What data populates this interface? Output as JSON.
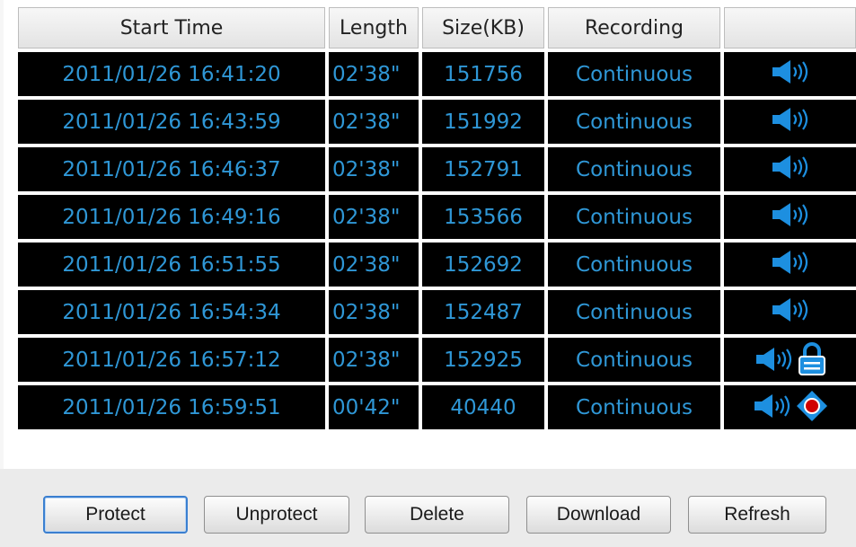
{
  "table": {
    "headers": [
      "Start Time",
      "Length",
      "Size(KB)",
      "Recording",
      ""
    ],
    "rows": [
      {
        "start": "2011/01/26 16:41:20",
        "length": "02'38\"",
        "size": "151756",
        "recording": "Continuous",
        "icons": [
          "speaker-icon"
        ]
      },
      {
        "start": "2011/01/26 16:43:59",
        "length": "02'38\"",
        "size": "151992",
        "recording": "Continuous",
        "icons": [
          "speaker-icon"
        ]
      },
      {
        "start": "2011/01/26 16:46:37",
        "length": "02'38\"",
        "size": "152791",
        "recording": "Continuous",
        "icons": [
          "speaker-icon"
        ]
      },
      {
        "start": "2011/01/26 16:49:16",
        "length": "02'38\"",
        "size": "153566",
        "recording": "Continuous",
        "icons": [
          "speaker-icon"
        ]
      },
      {
        "start": "2011/01/26 16:51:55",
        "length": "02'38\"",
        "size": "152692",
        "recording": "Continuous",
        "icons": [
          "speaker-icon"
        ]
      },
      {
        "start": "2011/01/26 16:54:34",
        "length": "02'38\"",
        "size": "152487",
        "recording": "Continuous",
        "icons": [
          "speaker-icon"
        ]
      },
      {
        "start": "2011/01/26 16:57:12",
        "length": "02'38\"",
        "size": "152925",
        "recording": "Continuous",
        "icons": [
          "speaker-icon",
          "lock-icon"
        ]
      },
      {
        "start": "2011/01/26 16:59:51",
        "length": "00'42\"",
        "size": "40440",
        "recording": "Continuous",
        "icons": [
          "speaker-icon",
          "recording-icon"
        ]
      }
    ]
  },
  "toolbar": {
    "protect": "Protect",
    "unprotect": "Unprotect",
    "delete": "Delete",
    "download": "Download",
    "refresh": "Refresh"
  },
  "colors": {
    "cell_background": "#000000",
    "cell_text": "#2f97d6",
    "icon_blue": "#1d8fe0",
    "record_red": "#d00000"
  }
}
